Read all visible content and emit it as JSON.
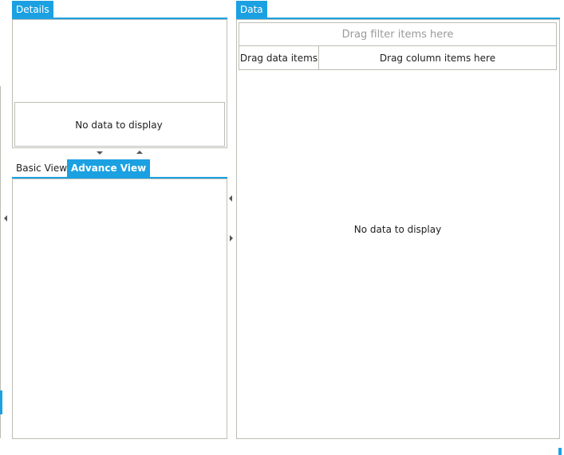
{
  "details": {
    "tab_label": "Details",
    "empty_message": "No data to display"
  },
  "views": {
    "tabs": [
      {
        "label": "Basic View",
        "active": false
      },
      {
        "label": "Advance View",
        "active": true
      }
    ]
  },
  "data_panel": {
    "tab_label": "Data",
    "filter_placeholder": "Drag filter items here",
    "data_items_label": "Drag data items",
    "column_items_label": "Drag column items here",
    "empty_message": "No data to display"
  },
  "colors": {
    "accent": "#1ba1e2",
    "border": "#bdbdb6"
  }
}
